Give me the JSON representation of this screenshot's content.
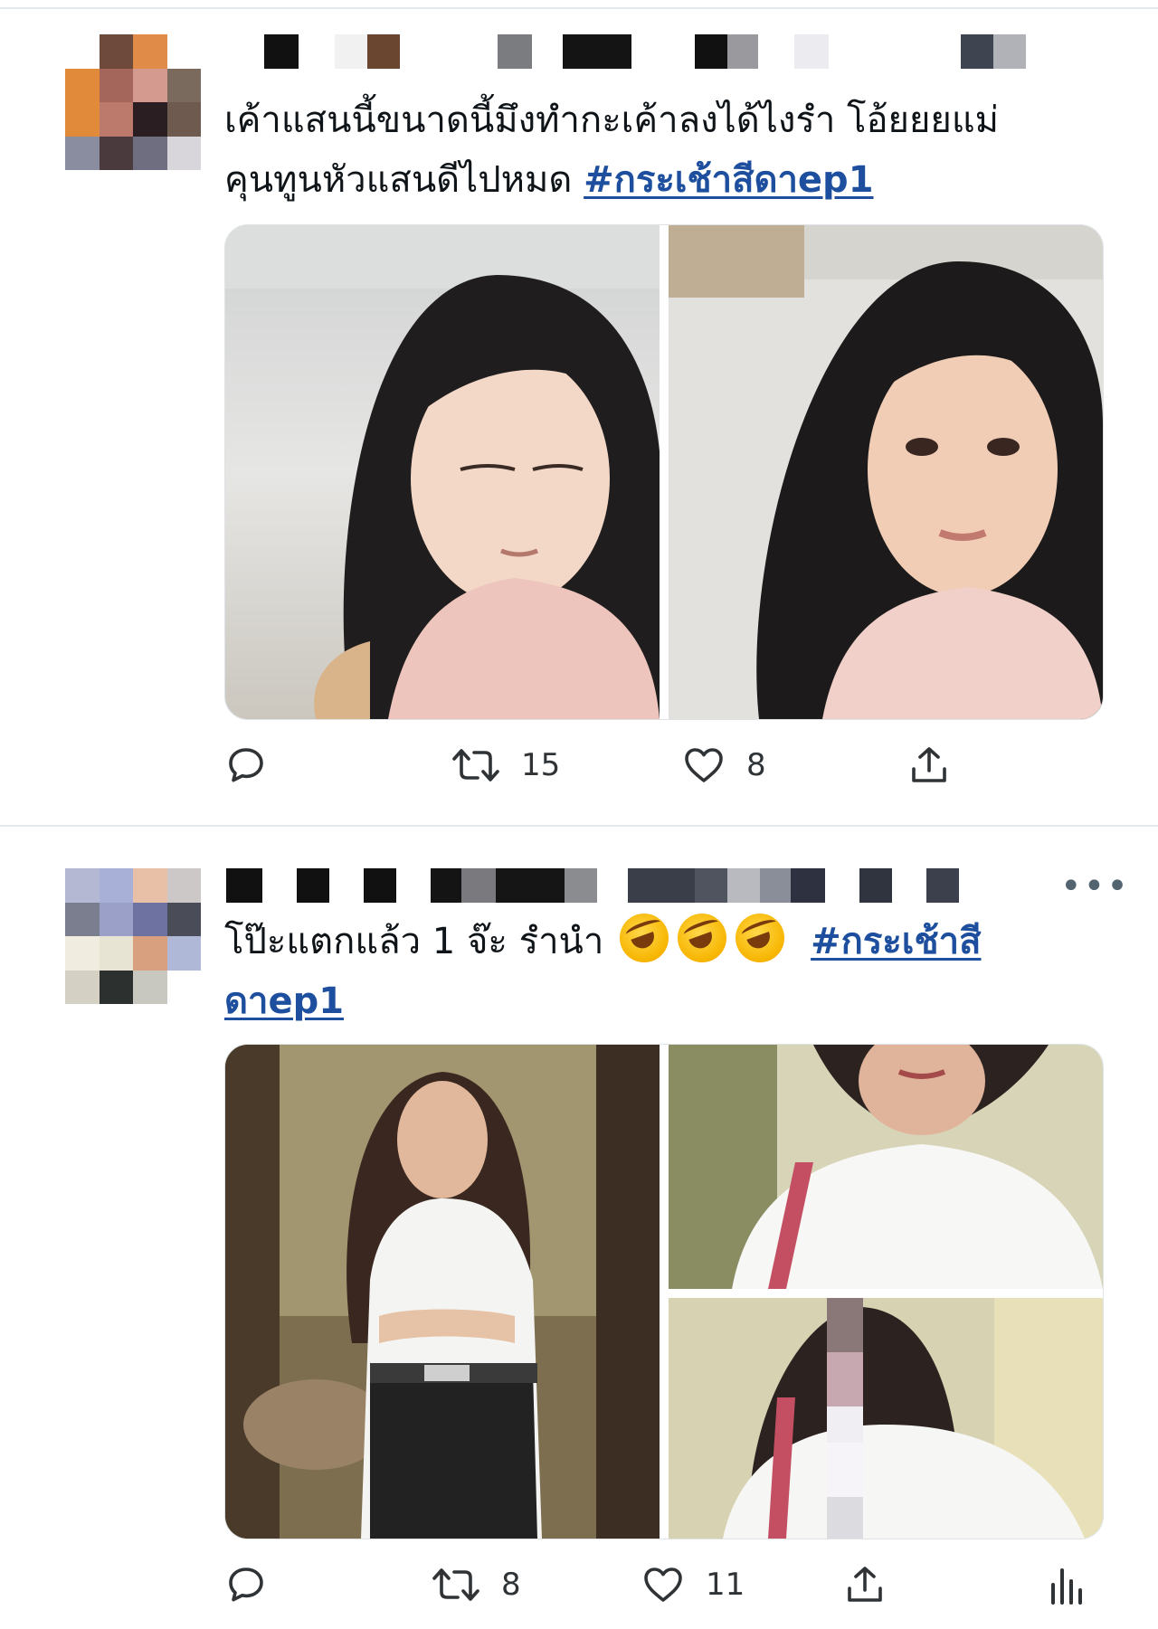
{
  "tweets": [
    {
      "text_line1": "เค้าแสนนี้ขนาดนี้มึงทำกะเค้าลงได้ไงรำ โอ้ยยยแม่",
      "text_line2": "คุนทูนหัวแสนดีไปหมด ",
      "hashtag": "#กระเช้าสีดาep1",
      "images": [
        "woman-looking-down-photo",
        "woman-looking-up-photo"
      ],
      "actions": {
        "reply_icon": "reply-icon",
        "retweet_icon": "retweet-icon",
        "retweet_count": "15",
        "like_icon": "heart-icon",
        "like_count": "8",
        "share_icon": "share-icon"
      }
    },
    {
      "text_line1": "โป๊ะแตกแล้ว 1 จ๊ะ รำนำ ",
      "hashtag_part1": "#กระเช้าสี",
      "hashtag_part2": "ดาep1",
      "emoji": [
        "rolling-on-floor-laughing",
        "rolling-on-floor-laughing",
        "rolling-on-floor-laughing"
      ],
      "images": [
        "student-uniform-photo-1",
        "student-uniform-photo-2",
        "student-uniform-photo-3"
      ],
      "more_label": "•••",
      "actions": {
        "reply_icon": "reply-icon",
        "retweet_icon": "retweet-icon",
        "retweet_count": "8",
        "like_icon": "heart-icon",
        "like_count": "11",
        "share_icon": "share-icon",
        "analytics_icon": "analytics-icon"
      }
    }
  ],
  "colors": {
    "hashtag": "#1d4f9e",
    "icon": "#536471",
    "divider": "#e6e9ec"
  }
}
